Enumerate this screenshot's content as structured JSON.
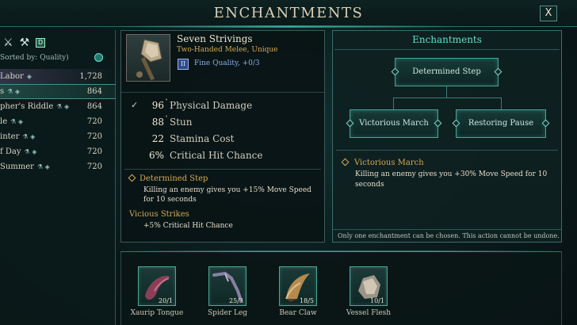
{
  "window": {
    "title": "ENCHANTMENTS",
    "close_label": "X"
  },
  "sidebar": {
    "badge": "D",
    "sorted_label": "Sorted by: Quality)",
    "items": [
      {
        "name": "Labor",
        "marks": "◈",
        "value": "1,728"
      },
      {
        "name": "s",
        "marks": "⚗ ◈",
        "value": "864"
      },
      {
        "name": "pher's Riddle",
        "marks": "⚗ ◈",
        "value": "864"
      },
      {
        "name": "le",
        "marks": "⚗ ◈",
        "value": "720"
      },
      {
        "name": "inter",
        "marks": "⚗ ◈",
        "value": "720"
      },
      {
        "name": "f Day",
        "marks": "⚗ ◈",
        "value": "720"
      },
      {
        "name": "Summer",
        "marks": "⚗ ◈",
        "value": "720"
      }
    ]
  },
  "item": {
    "name": "Seven Strivings",
    "type": "Two-Handed Melee, Unique",
    "quality_badge": "II",
    "quality": "Fine Quality, +0/3",
    "stats": [
      {
        "check": "✓",
        "value": "96",
        "up": "˄",
        "label": "Physical Damage"
      },
      {
        "check": "",
        "value": "88",
        "up": "˄",
        "label": "Stun"
      },
      {
        "check": "",
        "value": "22",
        "up": "",
        "label": "Stamina Cost"
      },
      {
        "check": "",
        "value": "6%",
        "up": "",
        "label": "Critical Hit Chance"
      }
    ],
    "enchant_name": "Determined Step",
    "enchant_desc": "Killing an enemy gives you +15% Move Speed for 10 seconds",
    "second_name": "Vicious Strikes",
    "second_desc": "+5% Critical Hit Chance"
  },
  "enchantments": {
    "title": "Enchantments",
    "nodes": [
      "Determined Step",
      "Victorious March",
      "Restoring Pause"
    ],
    "selected_name": "Victorious March",
    "selected_desc": "Killing an enemy gives you +30% Move Speed for 10 seconds",
    "footer": "Only one enchantment can be chosen. This action cannot be undone."
  },
  "materials": [
    {
      "name": "Xaurip Tongue",
      "count": "20/1",
      "icon": "tongue-icon"
    },
    {
      "name": "Spider Leg",
      "count": "25/3",
      "icon": "spider-leg-icon"
    },
    {
      "name": "Bear Claw",
      "count": "18/5",
      "icon": "claw-icon"
    },
    {
      "name": "Vessel Flesh",
      "count": "10/1",
      "icon": "flesh-icon"
    }
  ]
}
